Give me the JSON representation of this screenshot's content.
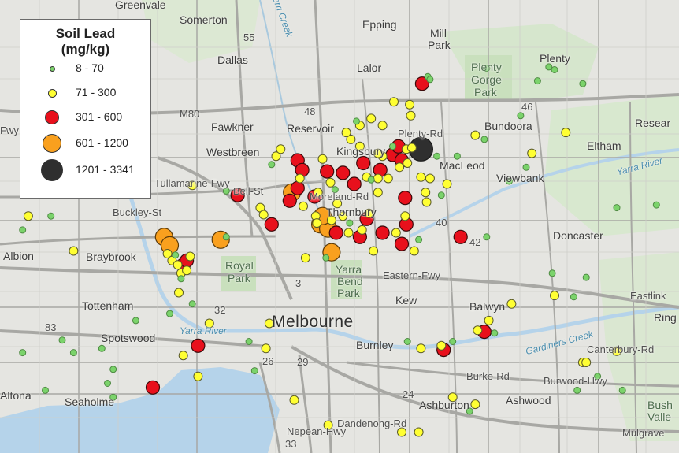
{
  "legend": {
    "title_line1": "Soil Lead",
    "title_line2": "(mg/kg)",
    "classes": [
      {
        "label": "8 - 70",
        "color": "#7bd36b"
      },
      {
        "label": "71 - 300",
        "color": "#ffff33"
      },
      {
        "label": "301 - 600",
        "color": "#e8101c"
      },
      {
        "label": "601 - 1200",
        "color": "#f9a01e"
      },
      {
        "label": "1201 - 3341",
        "color": "#2f2f2f"
      }
    ]
  },
  "places": {
    "greenvale": "Greenvale",
    "somerton": "Somerton",
    "epping": "Epping",
    "mill_park_1": "Mill",
    "mill_park_2": "Park",
    "dallas": "Dallas",
    "lalor": "Lalor",
    "plenty_gorge_1": "Plenty",
    "plenty_gorge_2": "Gorge",
    "plenty_gorge_3": "Park",
    "plenty": "Plenty",
    "fawkner": "Fawkner",
    "reservoir": "Reservoir",
    "bundoora": "Bundoora",
    "research": "Resear",
    "westbreen": "Westbreen",
    "kingsbury": "Kingsbury",
    "eltham": "Eltham",
    "macleod": "MacLeod",
    "viewbank": "Viewbank",
    "thornbury": "Thornbury",
    "doncaster": "Doncaster",
    "albion": "Albion",
    "braybrook": "Braybrook",
    "royal_park_1": "Royal",
    "royal_park_2": "Park",
    "yarra_bend_1": "Yarra",
    "yarra_bend_2": "Bend",
    "yarra_bend_3": "Park",
    "tottenham": "Tottenham",
    "kew": "Kew",
    "balwyn": "Balwyn",
    "melbourne": "Melbourne",
    "spotswood": "Spotswood",
    "burnley": "Burnley",
    "ringwood": "Ring",
    "altona": "Altona",
    "seaholme": "Seaholme",
    "ashburton": "Ashburton",
    "ashwood": "Ashwood",
    "bush_valley_1": "Bush",
    "bush_valley_2": "Valle"
  },
  "roads": {
    "m80": "M80",
    "eastern_fwy": "Eastern-Fwy",
    "burwood_hwy": "Burwood-Hwy",
    "dandenong_rd": "Dandenong-Rd",
    "nepean_hwy": "Nepean-Hwy",
    "plenty_rd": "Plenty-Rd",
    "tullamarine_fwy": "Tullamarine-Fwy",
    "bell_st": "Bell-St",
    "buckley_st": "Buckley-St",
    "eastlink": "Eastlink",
    "fwy_west": "Fwy",
    "canterbury_rd": "Canterbury-Rd",
    "mulgrave_fwy": "Mulgrave",
    "burke_rd": "Burke-Rd",
    "moreland_rd": "Moreland-Rd",
    "route_55": "55",
    "route_48": "48",
    "route_46": "46",
    "route_42": "42",
    "route_40": "40",
    "route_83": "83",
    "route_32": "32",
    "route_29": "29",
    "route_26": "26",
    "route_24": "24",
    "route_33": "33",
    "route_3": "3"
  },
  "water": {
    "merri_creek": "Merri Creek",
    "yarra_river_1": "Yarra River",
    "yarra_river_2": "Yarra River",
    "gardiners_creek": "Gardiners Creek"
  },
  "samples": [
    {
      "cls": 1,
      "lon": 144.725,
      "lat": -37.785
    },
    {
      "cls": 1,
      "lon": 144.765,
      "lat": -37.81
    },
    {
      "cls": 0,
      "lon": 144.72,
      "lat": -37.795
    },
    {
      "cls": 0,
      "lon": 144.745,
      "lat": -37.785
    },
    {
      "cls": 3,
      "lon": 144.845,
      "lat": -37.8
    },
    {
      "cls": 3,
      "lon": 144.85,
      "lat": -37.806
    },
    {
      "cls": 1,
      "lon": 144.848,
      "lat": -37.812
    },
    {
      "cls": 1,
      "lon": 144.852,
      "lat": -37.817
    },
    {
      "cls": 1,
      "lon": 144.857,
      "lat": -37.82
    },
    {
      "cls": 2,
      "lon": 144.862,
      "lat": -37.82
    },
    {
      "cls": 1,
      "lon": 144.86,
      "lat": -37.826
    },
    {
      "cls": 1,
      "lon": 144.865,
      "lat": -37.824
    },
    {
      "cls": 2,
      "lon": 144.865,
      "lat": -37.817
    },
    {
      "cls": 1,
      "lon": 144.868,
      "lat": -37.814
    },
    {
      "cls": 0,
      "lon": 144.855,
      "lat": -37.813
    },
    {
      "cls": 3,
      "lon": 144.895,
      "lat": -37.802
    },
    {
      "cls": 0,
      "lon": 144.86,
      "lat": -37.83
    },
    {
      "cls": 1,
      "lon": 144.858,
      "lat": -37.84
    },
    {
      "cls": 0,
      "lon": 144.85,
      "lat": -37.855
    },
    {
      "cls": 0,
      "lon": 144.87,
      "lat": -37.848
    },
    {
      "cls": 1,
      "lon": 144.885,
      "lat": -37.862
    },
    {
      "cls": 0,
      "lon": 144.82,
      "lat": -37.86
    },
    {
      "cls": 0,
      "lon": 144.755,
      "lat": -37.874
    },
    {
      "cls": 0,
      "lon": 144.765,
      "lat": -37.883
    },
    {
      "cls": 0,
      "lon": 144.72,
      "lat": -37.883
    },
    {
      "cls": 0,
      "lon": 144.79,
      "lat": -37.88
    },
    {
      "cls": 2,
      "lon": 144.875,
      "lat": -37.878
    },
    {
      "cls": 2,
      "lon": 144.91,
      "lat": -37.77
    },
    {
      "cls": 1,
      "lon": 144.93,
      "lat": -37.779
    },
    {
      "cls": 0,
      "lon": 144.9,
      "lat": -37.767
    },
    {
      "cls": 1,
      "lon": 144.87,
      "lat": -37.763
    },
    {
      "cls": 0,
      "lon": 144.9,
      "lat": -37.8
    },
    {
      "cls": 1,
      "lon": 144.933,
      "lat": -37.784
    },
    {
      "cls": 2,
      "lon": 144.94,
      "lat": -37.791
    },
    {
      "cls": 2,
      "lon": 144.956,
      "lat": -37.774
    },
    {
      "cls": 3,
      "lon": 144.958,
      "lat": -37.768
    },
    {
      "cls": 2,
      "lon": 144.963,
      "lat": -37.765
    },
    {
      "cls": 1,
      "lon": 144.965,
      "lat": -37.758
    },
    {
      "cls": 1,
      "lon": 144.944,
      "lat": -37.742
    },
    {
      "cls": 1,
      "lon": 144.948,
      "lat": -37.737
    },
    {
      "cls": 2,
      "lon": 144.963,
      "lat": -37.745
    },
    {
      "cls": 2,
      "lon": 144.967,
      "lat": -37.752
    },
    {
      "cls": 1,
      "lon": 144.968,
      "lat": -37.778
    },
    {
      "cls": 2,
      "lon": 144.978,
      "lat": -37.771
    },
    {
      "cls": 1,
      "lon": 144.981,
      "lat": -37.768
    },
    {
      "cls": 2,
      "lon": 144.989,
      "lat": -37.753
    },
    {
      "cls": 1,
      "lon": 144.985,
      "lat": -37.744
    },
    {
      "cls": 1,
      "lon": 144.992,
      "lat": -37.761
    },
    {
      "cls": 0,
      "lon": 144.996,
      "lat": -37.766
    },
    {
      "cls": 1,
      "lon": 144.998,
      "lat": -37.776
    },
    {
      "cls": 1,
      "lon": 144.979,
      "lat": -37.785
    },
    {
      "cls": 1,
      "lon": 144.98,
      "lat": -37.79
    },
    {
      "cls": 3,
      "lon": 144.983,
      "lat": -37.791
    },
    {
      "cls": 3,
      "lon": 144.99,
      "lat": -37.794
    },
    {
      "cls": 1,
      "lon": 144.993,
      "lat": -37.788
    },
    {
      "cls": 2,
      "lon": 144.997,
      "lat": -37.797
    },
    {
      "cls": 1,
      "lon": 145.003,
      "lat": -37.785
    },
    {
      "cls": 0,
      "lon": 145.009,
      "lat": -37.79
    },
    {
      "cls": 1,
      "lon": 145.008,
      "lat": -37.797
    },
    {
      "cls": 2,
      "lon": 145.018,
      "lat": -37.8
    },
    {
      "cls": 1,
      "lon": 145.02,
      "lat": -37.795
    },
    {
      "cls": 2,
      "lon": 145.024,
      "lat": -37.787
    },
    {
      "cls": 1,
      "lon": 145.026,
      "lat": -37.783
    },
    {
      "cls": 3,
      "lon": 144.993,
      "lat": -37.811
    },
    {
      "cls": 0,
      "lon": 144.988,
      "lat": -37.815
    },
    {
      "cls": 2,
      "lon": 145.003,
      "lat": -37.754
    },
    {
      "cls": 2,
      "lon": 145.013,
      "lat": -37.762
    },
    {
      "cls": 2,
      "lon": 145.021,
      "lat": -37.747
    },
    {
      "cls": 1,
      "lon": 145.018,
      "lat": -37.735
    },
    {
      "cls": 1,
      "lon": 145.01,
      "lat": -37.73
    },
    {
      "cls": 1,
      "lon": 145.006,
      "lat": -37.725
    },
    {
      "cls": 1,
      "lon": 145.024,
      "lat": -37.757
    },
    {
      "cls": 0,
      "lon": 145.028,
      "lat": -37.759
    },
    {
      "cls": 1,
      "lon": 145.034,
      "lat": -37.758
    },
    {
      "cls": 2,
      "lon": 145.036,
      "lat": -37.752
    },
    {
      "cls": 1,
      "lon": 145.043,
      "lat": -37.758
    },
    {
      "cls": 1,
      "lon": 145.034,
      "lat": -37.768
    },
    {
      "cls": 1,
      "lon": 145.038,
      "lat": -37.742
    },
    {
      "cls": 2,
      "lon": 145.047,
      "lat": -37.741
    },
    {
      "cls": 0,
      "lon": 145.047,
      "lat": -37.735
    },
    {
      "cls": 1,
      "lon": 145.053,
      "lat": -37.75
    },
    {
      "cls": 1,
      "lon": 145.059,
      "lat": -37.737
    },
    {
      "cls": 2,
      "lon": 145.052,
      "lat": -37.735
    },
    {
      "cls": 4,
      "lon": 145.072,
      "lat": -37.737
    },
    {
      "cls": 1,
      "lon": 145.064,
      "lat": -37.736
    },
    {
      "cls": 1,
      "lon": 145.072,
      "lat": -37.757
    },
    {
      "cls": 1,
      "lon": 145.08,
      "lat": -37.758
    },
    {
      "cls": 1,
      "lon": 145.076,
      "lat": -37.768
    },
    {
      "cls": 1,
      "lon": 145.077,
      "lat": -37.775
    },
    {
      "cls": 2,
      "lon": 145.058,
      "lat": -37.772
    },
    {
      "cls": 1,
      "lon": 145.058,
      "lat": -37.785
    },
    {
      "cls": 2,
      "lon": 145.059,
      "lat": -37.791
    },
    {
      "cls": 2,
      "lon": 145.038,
      "lat": -37.797
    },
    {
      "cls": 1,
      "lon": 145.05,
      "lat": -37.797
    },
    {
      "cls": 2,
      "lon": 145.055,
      "lat": -37.805
    },
    {
      "cls": 1,
      "lon": 145.066,
      "lat": -37.81
    },
    {
      "cls": 0,
      "lon": 145.07,
      "lat": -37.802
    },
    {
      "cls": 2,
      "lon": 145.107,
      "lat": -37.8
    },
    {
      "cls": 2,
      "lon": 145.073,
      "lat": -37.69
    },
    {
      "cls": 0,
      "lon": 145.078,
      "lat": -37.685
    },
    {
      "cls": 1,
      "lon": 145.062,
      "lat": -37.705
    },
    {
      "cls": 1,
      "lon": 145.063,
      "lat": -37.713
    },
    {
      "cls": 0,
      "lon": 145.015,
      "lat": -37.717
    },
    {
      "cls": 1,
      "lon": 145.028,
      "lat": -37.715
    },
    {
      "cls": 1,
      "lon": 145.018,
      "lat": -37.72
    },
    {
      "cls": 1,
      "lon": 145.038,
      "lat": -37.72
    },
    {
      "cls": 1,
      "lon": 145.048,
      "lat": -37.703
    },
    {
      "cls": 1,
      "lon": 145.034,
      "lat": -37.74
    },
    {
      "cls": 1,
      "lon": 145.06,
      "lat": -37.747
    },
    {
      "cls": 2,
      "lon": 145.055,
      "lat": -37.745
    },
    {
      "cls": 1,
      "lon": 145.12,
      "lat": -37.727
    },
    {
      "cls": 0,
      "lon": 145.128,
      "lat": -37.73
    },
    {
      "cls": 1,
      "lon": 145.095,
      "lat": -37.762
    },
    {
      "cls": 0,
      "lon": 145.09,
      "lat": -37.77
    },
    {
      "cls": 0,
      "lon": 145.086,
      "lat": -37.742
    },
    {
      "cls": 0,
      "lon": 145.104,
      "lat": -37.742
    },
    {
      "cls": 0,
      "lon": 145.08,
      "lat": -37.687
    },
    {
      "cls": 0,
      "lon": 145.13,
      "lat": -37.679
    },
    {
      "cls": 0,
      "lon": 145.175,
      "lat": -37.688
    },
    {
      "cls": 0,
      "lon": 145.185,
      "lat": -37.678
    },
    {
      "cls": 0,
      "lon": 145.19,
      "lat": -37.68
    },
    {
      "cls": 0,
      "lon": 145.215,
      "lat": -37.69
    },
    {
      "cls": 1,
      "lon": 145.2,
      "lat": -37.725
    },
    {
      "cls": 0,
      "lon": 145.16,
      "lat": -37.713
    },
    {
      "cls": 1,
      "lon": 145.17,
      "lat": -37.74
    },
    {
      "cls": 0,
      "lon": 145.165,
      "lat": -37.75
    },
    {
      "cls": 0,
      "lon": 145.15,
      "lat": -37.76
    },
    {
      "cls": 0,
      "lon": 145.245,
      "lat": -37.779
    },
    {
      "cls": 0,
      "lon": 145.28,
      "lat": -37.777
    },
    {
      "cls": 0,
      "lon": 145.13,
      "lat": -37.8
    },
    {
      "cls": 0,
      "lon": 145.188,
      "lat": -37.826
    },
    {
      "cls": 1,
      "lon": 145.19,
      "lat": -37.842
    },
    {
      "cls": 0,
      "lon": 145.218,
      "lat": -37.829
    },
    {
      "cls": 0,
      "lon": 145.207,
      "lat": -37.843
    },
    {
      "cls": 1,
      "lon": 145.152,
      "lat": -37.848
    },
    {
      "cls": 1,
      "lon": 145.132,
      "lat": -37.86
    },
    {
      "cls": 1,
      "lon": 145.122,
      "lat": -37.867
    },
    {
      "cls": 2,
      "lon": 145.128,
      "lat": -37.868
    },
    {
      "cls": 0,
      "lon": 145.137,
      "lat": -37.869
    },
    {
      "cls": 1,
      "lon": 145.215,
      "lat": -37.89
    },
    {
      "cls": 1,
      "lon": 145.218,
      "lat": -37.89
    },
    {
      "cls": 1,
      "lon": 145.245,
      "lat": -37.882
    },
    {
      "cls": 0,
      "lon": 145.21,
      "lat": -37.91
    },
    {
      "cls": 0,
      "lon": 145.228,
      "lat": -37.9
    },
    {
      "cls": 0,
      "lon": 145.25,
      "lat": -37.91
    },
    {
      "cls": 1,
      "lon": 145.12,
      "lat": -37.92
    },
    {
      "cls": 1,
      "lon": 144.96,
      "lat": -37.917
    },
    {
      "cls": 1,
      "lon": 144.99,
      "lat": -37.935
    },
    {
      "cls": 1,
      "lon": 145.055,
      "lat": -37.94
    },
    {
      "cls": 1,
      "lon": 145.07,
      "lat": -37.94
    },
    {
      "cls": 0,
      "lon": 145.115,
      "lat": -37.925
    },
    {
      "cls": 1,
      "lon": 145.1,
      "lat": -37.915
    },
    {
      "cls": 1,
      "lon": 144.938,
      "lat": -37.862
    },
    {
      "cls": 1,
      "lon": 144.935,
      "lat": -37.88
    },
    {
      "cls": 0,
      "lon": 144.92,
      "lat": -37.875
    },
    {
      "cls": 0,
      "lon": 144.925,
      "lat": -37.896
    },
    {
      "cls": 1,
      "lon": 144.875,
      "lat": -37.9
    },
    {
      "cls": 1,
      "lon": 144.862,
      "lat": -37.885
    },
    {
      "cls": 2,
      "lon": 144.835,
      "lat": -37.908
    },
    {
      "cls": 0,
      "lon": 144.8,
      "lat": -37.895
    },
    {
      "cls": 0,
      "lon": 144.8,
      "lat": -37.915
    },
    {
      "cls": 0,
      "lon": 144.74,
      "lat": -37.91
    },
    {
      "cls": 0,
      "lon": 144.795,
      "lat": -37.905
    },
    {
      "cls": 0,
      "lon": 145.06,
      "lat": -37.875
    },
    {
      "cls": 1,
      "lon": 145.072,
      "lat": -37.88
    },
    {
      "cls": 1,
      "lon": 145.09,
      "lat": -37.878
    },
    {
      "cls": 2,
      "lon": 145.092,
      "lat": -37.881
    },
    {
      "cls": 0,
      "lon": 145.1,
      "lat": -37.875
    },
    {
      "cls": 1,
      "lon": 145.03,
      "lat": -37.81
    },
    {
      "cls": 1,
      "lon": 144.97,
      "lat": -37.815
    },
    {
      "cls": 3,
      "lon": 144.985,
      "lat": -37.785
    },
    {
      "cls": 0,
      "lon": 144.94,
      "lat": -37.748
    }
  ]
}
